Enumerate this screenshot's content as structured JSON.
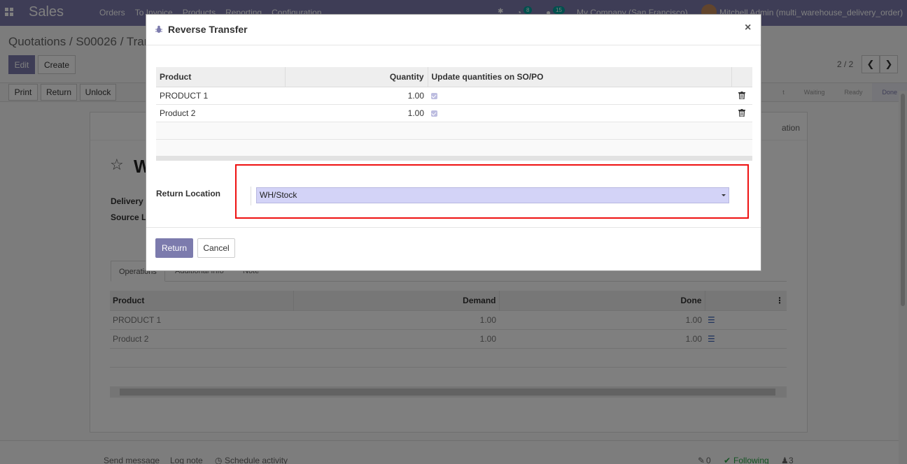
{
  "navbar": {
    "brand": "Sales",
    "menu": [
      "Orders",
      "To Invoice",
      "Products",
      "Reporting",
      "Configuration"
    ],
    "message_count": "8",
    "activity_count": "15",
    "company": "My Company (San Francisco)",
    "user": "Mitchell Admin (multi_warehouse_delivery_order)"
  },
  "breadcrumb": "Quotations / S00026 / Tran",
  "toolbar": {
    "edit": "Edit",
    "create": "Create"
  },
  "pager": {
    "value": "2 / 2"
  },
  "actions": {
    "print": "Print",
    "return": "Return",
    "unlock": "Unlock"
  },
  "status_steps": [
    "t",
    "Waiting",
    "Ready",
    "Done"
  ],
  "sheet": {
    "head_right": "ation",
    "title": "W",
    "labels": [
      "Delivery A",
      "Source L"
    ],
    "tabs": [
      "Operations",
      "Additional Info",
      "Note"
    ],
    "table": {
      "headers": [
        "Product",
        "Demand",
        "Done"
      ],
      "rows": [
        {
          "product": "PRODUCT 1",
          "demand": "1.00",
          "done": "1.00"
        },
        {
          "product": "Product 2",
          "demand": "1.00",
          "done": "1.00"
        }
      ]
    }
  },
  "chatter": {
    "send_message": "Send message",
    "log_note": "Log note",
    "schedule": "Schedule activity",
    "attachments": "0",
    "following": "Following",
    "followers": "3"
  },
  "modal": {
    "title": "Reverse Transfer",
    "close": "×",
    "table": {
      "headers": [
        "Product",
        "Quantity",
        "Update quantities on SO/PO"
      ],
      "rows": [
        {
          "product": "PRODUCT 1",
          "quantity": "1.00"
        },
        {
          "product": "Product 2",
          "quantity": "1.00"
        }
      ]
    },
    "return_location_label": "Return Location",
    "return_location_value": "WH/Stock",
    "buttons": {
      "return": "Return",
      "cancel": "Cancel"
    }
  },
  "colors": {
    "brand": "#7c7bad",
    "highlight": "#e11111",
    "select_bg": "#d3d3f7"
  }
}
